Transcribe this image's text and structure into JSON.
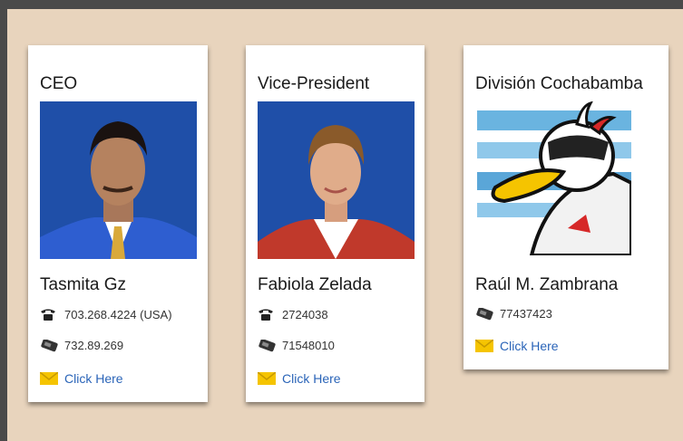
{
  "cards": [
    {
      "title": "CEO",
      "name": "Tasmita Gz",
      "phone": "703.268.4224 (USA)",
      "mobile": "732.89.269",
      "email_link": "Click Here"
    },
    {
      "title": "Vice-President",
      "name": "Fabiola Zelada",
      "phone": "2724038",
      "mobile": "71548010",
      "email_link": "Click Here"
    },
    {
      "title": "División Cochabamba",
      "name": "Raúl M. Zambrana",
      "mobile": "77437423",
      "email_link": "Click Here"
    }
  ],
  "colors": {
    "background": "#e8d4bd",
    "frame": "#4a4a4a",
    "link": "#2a64b8",
    "photo_bg": "#1f4fa8"
  },
  "icons": [
    "telephone-icon",
    "mobile-phone-icon",
    "envelope-icon"
  ]
}
